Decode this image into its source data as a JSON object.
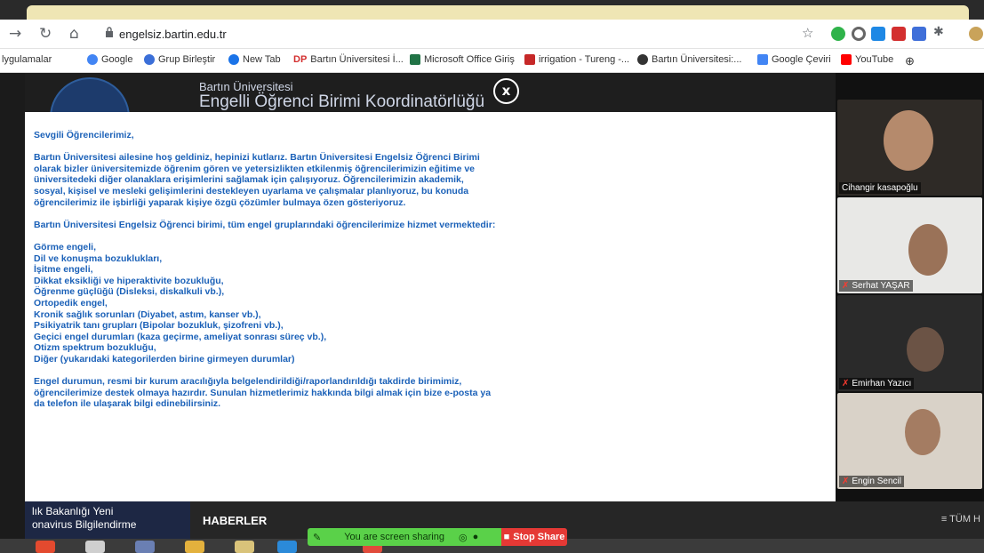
{
  "browser": {
    "url": "engelsiz.bartin.edu.tr",
    "bookmarks": [
      "lygulamalar",
      "Google",
      "Grup Birleştir",
      "New Tab",
      "Bartın Üniversitesi İ...",
      "Microsoft Office Giriş",
      "irrigation - Tureng -...",
      "Bartın Üniversitesi:...",
      "Google Çeviri",
      "YouTube"
    ],
    "bookmark_prefix_dp": "DP"
  },
  "site": {
    "university": "Bartın Üniversitesi",
    "unit": "Engelli Öğrenci Birimi Koordinatörlüğü",
    "close_label": "x",
    "news_left_line1": "lık Bakanlığı Yeni",
    "news_left_line2": "onavirus Bilgilendirme",
    "news_title": "HABERLER",
    "all_label": "≡ TÜM H"
  },
  "modal": {
    "greeting": "Sevgili Öğrencilerimiz,",
    "para1": "Bartın Üniversitesi ailesine hoş geldiniz, hepinizi kutlarız. Bartın Üniversitesi Engelsiz Öğrenci Birimi olarak bizler üniversitemizde öğrenim gören ve yetersizlikten etkilenmiş öğrencilerimizin eğitime ve üniversitedeki diğer olanaklara erişimlerini sağlamak için çalışıyoruz. Öğrencilerimizin akademik, sosyal, kişisel ve mesleki gelişimlerini destekleyen uyarlama ve çalışmalar planlıyoruz, bu konuda öğrencilerimiz ile işbirliği yaparak kişiye özgü çözümler bulmaya özen gösteriyoruz.",
    "para2": "Bartın Üniversitesi Engelsiz Öğrenci birimi, tüm engel gruplarındaki öğrencilerimize hizmet vermektedir:",
    "list": [
      "Görme engeli,",
      "Dil ve konuşma bozuklukları,",
      "İşitme engeli,",
      "Dikkat eksikliği ve hiperaktivite bozukluğu,",
      "Öğrenme güçlüğü (Disleksi, diskalkuli vb.),",
      "Ortopedik engel,",
      "Kronik sağlık sorunları (Diyabet, astım, kanser vb.),",
      "Psikiyatrik tanı grupları (Bipolar bozukluk, şizofreni vb.),",
      "Geçici engel durumları (kaza geçirme, ameliyat sonrası süreç vb.),",
      "Otizm spektrum bozukluğu,",
      "Diğer (yukarıdaki kategorilerden birine girmeyen durumlar)"
    ],
    "para3": "Engel durumun, resmi bir kurum aracılığıyla belgelendirildiği/raporlandırıldığı takdirde birimimiz, öğrencilerimize destek olmaya hazırdır. Sunulan hizmetlerimiz hakkında bilgi almak için bize e-posta ya da telefon ile ulaşarak bilgi edinebilirsiniz."
  },
  "participants": [
    {
      "name": "Cihangir kasapoğlu"
    },
    {
      "name": "Serhat YAŞAR"
    },
    {
      "name": "Emirhan Yazıcı"
    },
    {
      "name": "Engin Sencil"
    }
  ],
  "share_bar": {
    "status": "You are screen sharing",
    "stop": "Stop Share"
  },
  "colors": {
    "modal_text": "#1b61b8",
    "share_green": "#5ad149",
    "stop_red": "#e53935"
  }
}
